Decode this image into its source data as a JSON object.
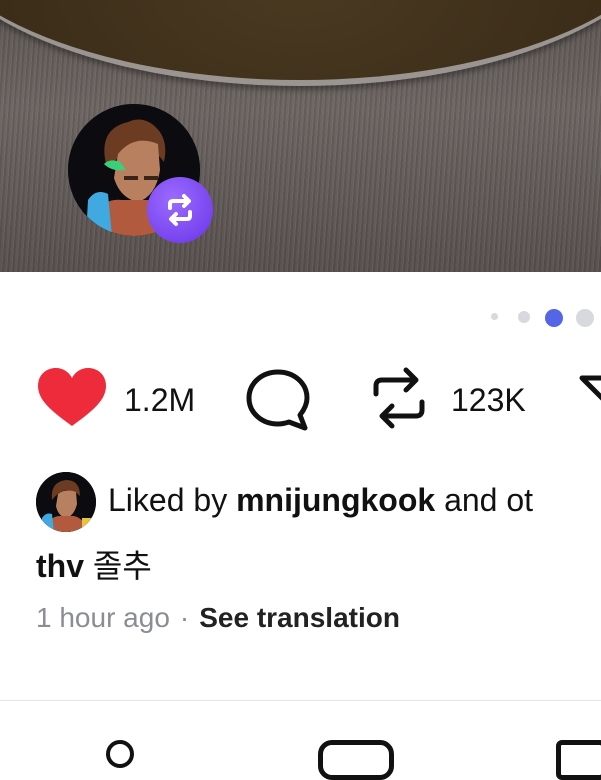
{
  "post": {
    "likes_count": "1.2M",
    "reposts_count": "123K",
    "liked_by_prefix": "Liked by ",
    "liked_by_user": "mnijungkook",
    "liked_by_suffix": " and ot",
    "caption_user": "thv",
    "caption_text": "졸추",
    "time": "1 hour ago",
    "separator": "·",
    "translate_label": "See translation"
  },
  "carousel": {
    "total_visible_dots": 4,
    "active_index": 2
  },
  "colors": {
    "heart": "#ee2b3a",
    "active_dot": "#5565e8",
    "repost_badge": "#7a45f0"
  },
  "icons": {
    "like": "heart-icon",
    "comment": "comment-bubble-icon",
    "repost": "repost-arrows-icon",
    "share": "share-icon"
  }
}
